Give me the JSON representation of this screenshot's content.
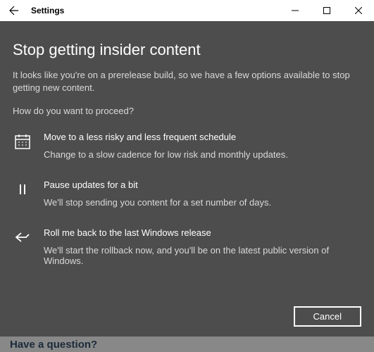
{
  "titlebar": {
    "title": "Settings"
  },
  "background": {
    "question": "Have a question?"
  },
  "modal": {
    "heading": "Stop getting insider content",
    "intro": "It looks like you're on a prerelease build, so we have a few options available to stop getting new content.",
    "prompt": "How do you want to proceed?",
    "options": [
      {
        "title": "Move to a less risky and less frequent schedule",
        "desc": "Change to a slow cadence for low risk and monthly updates."
      },
      {
        "title": "Pause updates for a bit",
        "desc": "We'll stop sending you content for a set number of days."
      },
      {
        "title": "Roll me back to the last Windows release",
        "desc": "We'll start the rollback now, and you'll be on the latest public version of Windows."
      }
    ],
    "cancel": "Cancel"
  }
}
